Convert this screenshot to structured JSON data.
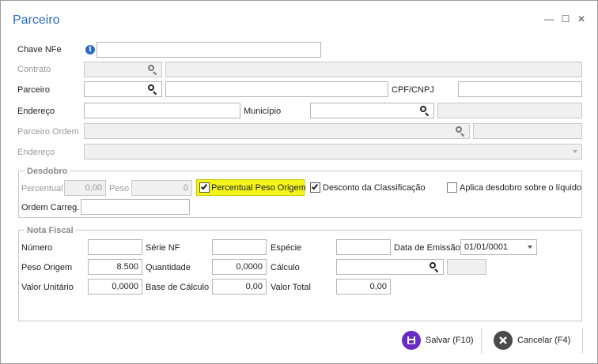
{
  "window": {
    "title": "Parceiro",
    "minimize_glyph": "—",
    "maximize_glyph": "☐",
    "close_glyph": "✕"
  },
  "form": {
    "chave_nfe": {
      "label": "Chave NFe",
      "value": ""
    },
    "contrato": {
      "label": "Contrato",
      "value": "",
      "description": ""
    },
    "parceiro": {
      "label": "Parceiro",
      "value": "",
      "description": ""
    },
    "cpf_cnpj": {
      "label": "CPF/CNPJ",
      "value": ""
    },
    "endereco": {
      "label": "Endereço",
      "value": ""
    },
    "municipio": {
      "label": "Município",
      "value": "",
      "description": ""
    },
    "parceiro_ordem": {
      "label": "Parceiro Ordem",
      "value": "",
      "description": ""
    },
    "endereco_ordem": {
      "label": "Endereço",
      "value": ""
    }
  },
  "desdobro": {
    "title": "Desdobro",
    "percentual_label": "Percentual",
    "percentual_value": "0,00",
    "peso_label": "Peso",
    "peso_value": "0",
    "percentual_peso_origem_label": "Percentual Peso Origem",
    "percentual_peso_origem_checked": true,
    "desconto_classificacao_label": "Desconto da Classificação",
    "desconto_classificacao_checked": true,
    "aplica_desdobro_label": "Aplica desdobro sobre o líquido",
    "aplica_desdobro_checked": false,
    "ordem_carreg_label": "Ordem Carreg.",
    "ordem_carreg_value": ""
  },
  "nota_fiscal": {
    "title": "Nota Fiscal",
    "numero_label": "Número",
    "numero_value": "",
    "serie_label": "Série NF",
    "serie_value": "",
    "especie_label": "Espécie",
    "especie_value": "",
    "data_emissao_label": "Data de Emissão",
    "data_emissao_value": "01/01/0001",
    "peso_origem_label": "Peso Origem",
    "peso_origem_value": "8.500",
    "quantidade_label": "Quantidade",
    "quantidade_value": "0,0000",
    "calculo_label": "Cálculo",
    "calculo_value": "",
    "calculo_description": "",
    "valor_unitario_label": "Valor Unitário",
    "valor_unitario_value": "0,0000",
    "base_calculo_label": "Base de Cálculo",
    "base_calculo_value": "0,00",
    "valor_total_label": "Valor Total",
    "valor_total_value": "0,00"
  },
  "actions": {
    "save_label": "Salvar (F10)",
    "cancel_label": "Cancelar (F4)",
    "save_color": "#6a2bc4",
    "cancel_color": "#4a4a4a"
  },
  "colors": {
    "title": "#2a6cc4",
    "highlight": "#f4f41a"
  }
}
